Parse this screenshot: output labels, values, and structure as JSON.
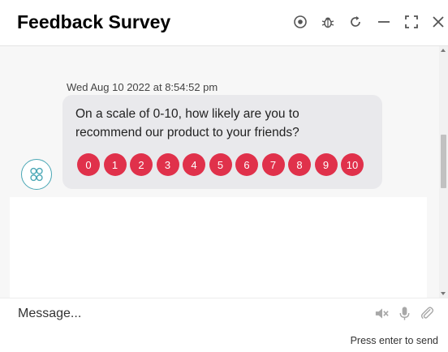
{
  "header": {
    "title": "Feedback Survey",
    "icons": [
      "record-icon",
      "bug-icon",
      "refresh-icon",
      "minimize-icon",
      "fullscreen-icon",
      "close-icon"
    ]
  },
  "chat": {
    "timestamp": "Wed Aug 10 2022 at 8:54:52 pm",
    "question": "On a scale of 0-10, how likely are you to recommend our product to your friends?",
    "ratings": [
      "0",
      "1",
      "2",
      "3",
      "4",
      "5",
      "6",
      "7",
      "8",
      "9",
      "10"
    ],
    "rating_color": "#e0314b"
  },
  "composer": {
    "placeholder": "Message...",
    "hint": "Press enter to send",
    "icons": [
      "mute-icon",
      "microphone-icon",
      "attachment-icon"
    ]
  },
  "colors": {
    "accent": "#e0314b",
    "avatar_ring": "#4aa7b5",
    "bubble_bg": "#e9e9ec"
  }
}
